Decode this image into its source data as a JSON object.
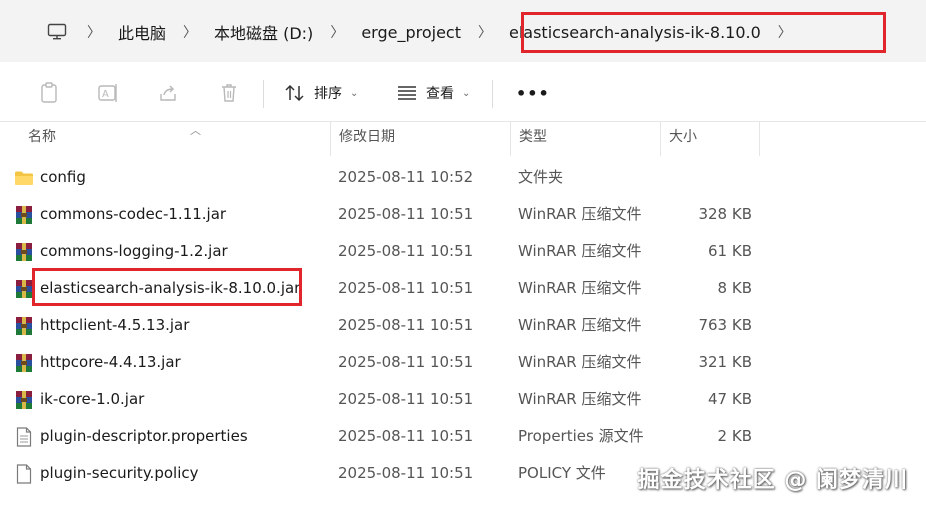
{
  "breadcrumb": {
    "items": [
      "此电脑",
      "本地磁盘 (D:)",
      "erge_project",
      "elasticsearch-analysis-ik-8.10.0"
    ]
  },
  "toolbar": {
    "sort_label": "排序",
    "view_label": "查看",
    "more_label": "•••"
  },
  "columns": {
    "name": "名称",
    "date": "修改日期",
    "type": "类型",
    "size": "大小"
  },
  "files": [
    {
      "name": "config",
      "date": "2025-08-11 10:52",
      "type": "文件夹",
      "size": "",
      "icon": "folder-icon"
    },
    {
      "name": "commons-codec-1.11.jar",
      "date": "2025-08-11 10:51",
      "type": "WinRAR 压缩文件",
      "size": "328 KB",
      "icon": "winrar-icon"
    },
    {
      "name": "commons-logging-1.2.jar",
      "date": "2025-08-11 10:51",
      "type": "WinRAR 压缩文件",
      "size": "61 KB",
      "icon": "winrar-icon"
    },
    {
      "name": "elasticsearch-analysis-ik-8.10.0.jar",
      "date": "2025-08-11 10:51",
      "type": "WinRAR 压缩文件",
      "size": "8 KB",
      "icon": "winrar-icon"
    },
    {
      "name": "httpclient-4.5.13.jar",
      "date": "2025-08-11 10:51",
      "type": "WinRAR 压缩文件",
      "size": "763 KB",
      "icon": "winrar-icon"
    },
    {
      "name": "httpcore-4.4.13.jar",
      "date": "2025-08-11 10:51",
      "type": "WinRAR 压缩文件",
      "size": "321 KB",
      "icon": "winrar-icon"
    },
    {
      "name": "ik-core-1.0.jar",
      "date": "2025-08-11 10:51",
      "type": "WinRAR 压缩文件",
      "size": "47 KB",
      "icon": "winrar-icon"
    },
    {
      "name": "plugin-descriptor.properties",
      "date": "2025-08-11 10:51",
      "type": "Properties 源文件",
      "size": "2 KB",
      "icon": "document-icon"
    },
    {
      "name": "plugin-security.policy",
      "date": "2025-08-11 10:51",
      "type": "POLICY 文件",
      "size": "",
      "icon": "document-icon"
    }
  ],
  "watermark": "掘金技术社区 @ 阑梦清川",
  "colors": {
    "highlight": "#e0262b",
    "folder": "#f4c542"
  }
}
